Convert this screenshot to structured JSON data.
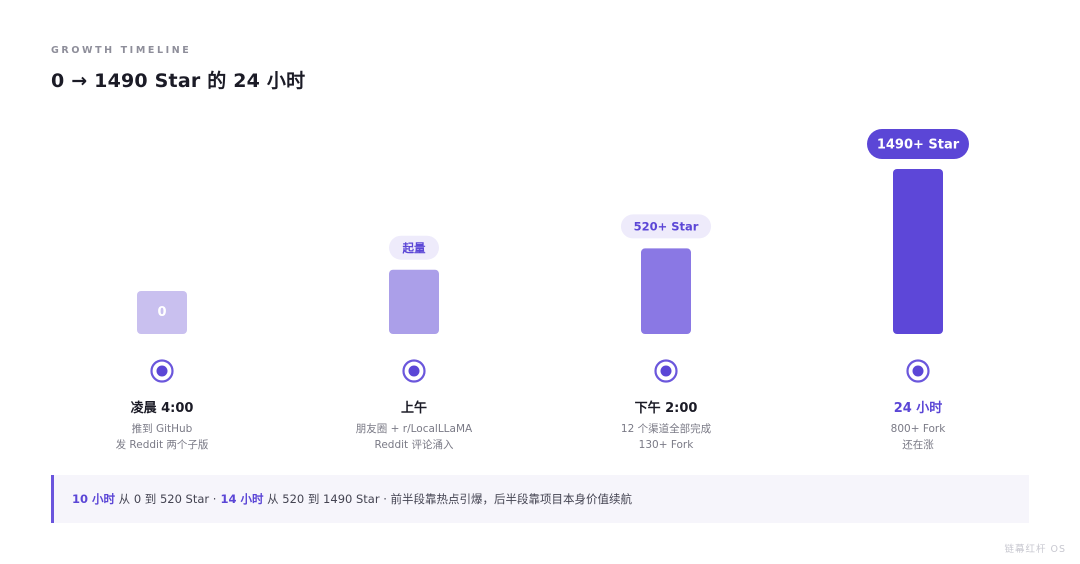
{
  "header": {
    "eyebrow": "GROWTH TIMELINE",
    "title": "0 → 1490 Star 的 24 小时"
  },
  "chart_data": {
    "type": "bar",
    "categories": [
      "凌晨 4:00",
      "上午",
      "下午 2:00",
      "24 小时"
    ],
    "values": [
      0,
      260,
      520,
      1490
    ],
    "bar_labels": [
      "0",
      "起量",
      "520+ Star",
      "1490+ Star"
    ],
    "bar_colors": [
      "#c9c0ef",
      "#ab9fe9",
      "#8a78e4",
      "#5d47d8"
    ],
    "notes": [
      [
        "推到 GitHub",
        "发 Reddit 两个子版"
      ],
      [
        "朋友圈 + r/LocalLLaMA",
        "Reddit 评论涌入"
      ],
      [
        "12 个渠道全部完成",
        "130+ Fork"
      ],
      [
        "800+ Fork",
        "还在涨"
      ]
    ],
    "highlight_index": 3,
    "accent": "#5b46d6",
    "timeline_color": "#6b57dc"
  },
  "stages": [
    {
      "time": "凌晨 4:00",
      "line1": "推到 GitHub",
      "line2": "发 Reddit 两个子版"
    },
    {
      "time": "上午",
      "line1": "朋友圈 + r/LocalLLaMA",
      "line2": "Reddit 评论涌入"
    },
    {
      "time": "下午 2:00",
      "line1": "12 个渠道全部完成",
      "line2": "130+ Fork"
    },
    {
      "time": "24 小时",
      "line1": "800+ Fork",
      "line2": "还在涨"
    }
  ],
  "summary": {
    "a_bold": "10 小时",
    "a_text": "从 0 到 520 Star ·",
    "b_bold": "14 小时",
    "b_text": "从 520 到 1490 Star · 前半段靠热点引爆，后半段靠项目本身价值续航"
  },
  "brand": "链幕红杆 OS"
}
